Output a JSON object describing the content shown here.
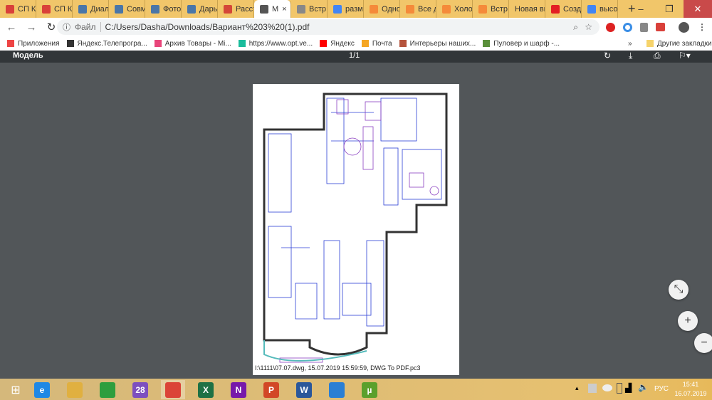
{
  "tabs": [
    {
      "title": "СП К",
      "color": "#d9403a"
    },
    {
      "title": "СП К",
      "color": "#d9403a"
    },
    {
      "title": "Диал",
      "color": "#4a76a8"
    },
    {
      "title": "Совм",
      "color": "#4a76a8"
    },
    {
      "title": "Фото",
      "color": "#4a76a8"
    },
    {
      "title": "Дары",
      "color": "#4a76a8"
    },
    {
      "title": "Расст",
      "color": "#d44638"
    },
    {
      "title": "М",
      "color": "#555",
      "active": true
    },
    {
      "title": "Встр",
      "color": "#888"
    },
    {
      "title": "разм",
      "color": "#4285f4"
    },
    {
      "title": "Одно",
      "color": "#f58a3a"
    },
    {
      "title": "Все д",
      "color": "#f58a3a"
    },
    {
      "title": "Холо",
      "color": "#f58a3a"
    },
    {
      "title": "Встр",
      "color": "#f58a3a"
    },
    {
      "title": "Новая вк",
      "color": ""
    },
    {
      "title": "Созд",
      "color": "#e31e24"
    },
    {
      "title": "высо",
      "color": "#4285f4"
    }
  ],
  "new_tab": "+",
  "window": {
    "minimize": "‒",
    "restore": "❐",
    "close": "✕"
  },
  "address": {
    "scheme_label": "Файл",
    "url": "C:/Users/Dasha/Downloads/Вариант%203%20(1).pdf"
  },
  "bookmarks": [
    {
      "label": "Приложения",
      "color": "#e44"
    },
    {
      "label": "Яндекс.Телепрогра...",
      "color": "#333"
    },
    {
      "label": "Архив Товары - Mi...",
      "color": "#e8457a"
    },
    {
      "label": "https://www.opt.ve...",
      "color": "#1abc9c"
    },
    {
      "label": "Яндекс",
      "color": "#f00"
    },
    {
      "label": "Почта",
      "color": "#f5a623"
    },
    {
      "label": "Интерьеры наших...",
      "color": "#b5533c"
    },
    {
      "label": "Пуловер и шарф -...",
      "color": "#5a8f3a"
    }
  ],
  "bookmarks_more": "»",
  "other_bookmarks": "Другие закладки",
  "pdf": {
    "title": "Модель",
    "page_indicator": "1/1",
    "caption": "I:\\1111\\07.07.dwg, 15.07.2019 15:59:59, DWG To PDF.pc3"
  },
  "zoom_controls": {
    "fit": "⤡",
    "plus": "+",
    "minus": "−"
  },
  "taskbar": {
    "apps": [
      {
        "name": "ie",
        "color": "#1e88e5",
        "label": "e"
      },
      {
        "name": "explorer",
        "color": "#e0b040",
        "label": ""
      },
      {
        "name": "store",
        "color": "#2e9e3e",
        "label": ""
      },
      {
        "name": "viber",
        "color": "#7d4fbf",
        "label": "28"
      },
      {
        "name": "chrome",
        "color": "#db4437",
        "label": ""
      },
      {
        "name": "excel",
        "color": "#1e7145",
        "label": "X"
      },
      {
        "name": "onenote",
        "color": "#7719aa",
        "label": "N"
      },
      {
        "name": "powerpoint",
        "color": "#d24726",
        "label": "P"
      },
      {
        "name": "word",
        "color": "#2b579a",
        "label": "W"
      },
      {
        "name": "app",
        "color": "#2a7fd4",
        "label": ""
      },
      {
        "name": "utorrent",
        "color": "#5aa02c",
        "label": "µ"
      }
    ],
    "lang": "РУС",
    "time": "15:41",
    "date": "16.07.2019"
  }
}
